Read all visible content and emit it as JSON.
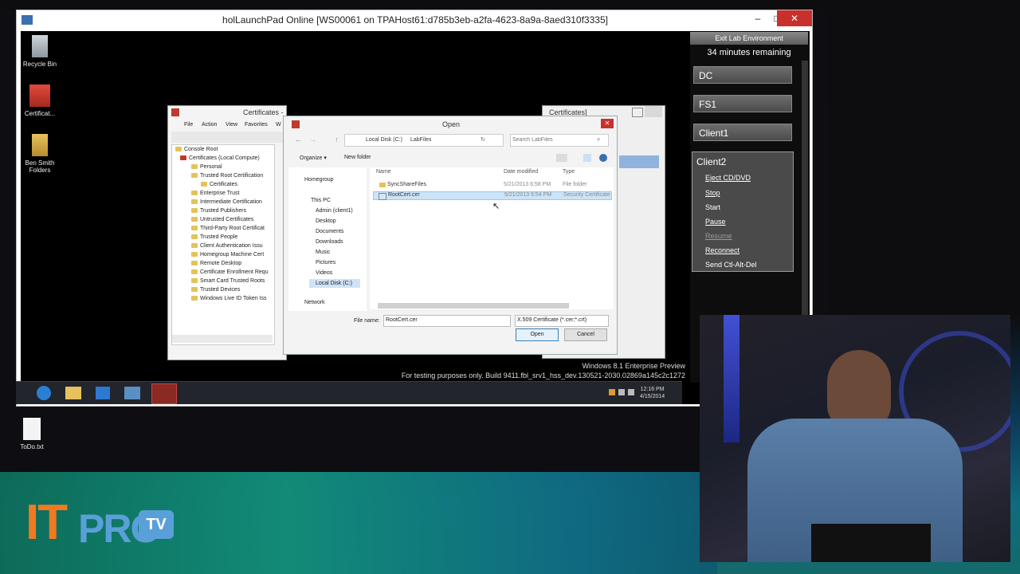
{
  "host_window": {
    "title": "holLaunchPad Online  [WS00061 on TPAHost61:d785b3eb-a2fa-4623-8a9a-8aed310f3335]",
    "minimize": "–",
    "maximize": "□",
    "close": "✕"
  },
  "vm_desktop": {
    "icons": [
      {
        "label": "Recycle Bin",
        "icon": "recycle-bin-icon"
      },
      {
        "label": "Certificat...",
        "icon": "certificate-icon"
      },
      {
        "label": "Ben Smith Folders",
        "icon": "folder-icon"
      }
    ],
    "watermark_line1": "Windows 8.1 Enterprise Preview",
    "watermark_line2": "For testing purposes only. Build 9411.fbl_srv1_hss_dev.130521-2030.02869a145c2c1272",
    "clock_time": "12:16 PM",
    "clock_date": "4/15/2014"
  },
  "outer_desktop": {
    "icons": [
      {
        "label": "ToDo.txt",
        "icon": "text-file-icon"
      }
    ]
  },
  "lab_panel": {
    "exit_label": "Exit Lab Environment",
    "remaining": "34 minutes remaining",
    "machines": [
      "DC",
      "FS1",
      "Client1",
      "Client2"
    ],
    "client2_actions": [
      "Eject CD/DVD",
      "Stop",
      "Start",
      "Pause",
      "Resume",
      "Reconnect",
      "Send Ctl-Alt-Del"
    ]
  },
  "cert_console": {
    "title": "Certificates -",
    "menu": [
      "File",
      "Action",
      "View",
      "Favorites",
      "W"
    ],
    "tree": [
      "Console Root",
      "Certificates (Local Compute)",
      "Personal",
      "Trusted Root Certification",
      "Certificates",
      "Enterprise Trust",
      "Intermediate Certification",
      "Trusted Publishers",
      "Untrusted Certificates",
      "Third-Party Root Certificat",
      "Trusted People",
      "Client Authentication Issu",
      "Homegroup Machine Cert",
      "Remote Desktop",
      "Certificate Enrollment Requ",
      "Smart Card Trusted Roots",
      "Trusted Devices",
      "Windows Live ID Token Iss"
    ]
  },
  "bg_window": {
    "title": "Certificates]"
  },
  "open_dialog": {
    "title": "Open",
    "path": [
      "Local Disk (C:)",
      "LabFiles"
    ],
    "search_placeholder": "Search LabFiles",
    "organize": "Organize ▾",
    "new_folder": "New folder",
    "nav": [
      "Homegroup",
      "This PC",
      "Admin (client1)",
      "Desktop",
      "Documents",
      "Downloads",
      "Music",
      "Pictures",
      "Videos",
      "Local Disk (C:)",
      "Network"
    ],
    "columns": [
      "Name",
      "Date modified",
      "Type"
    ],
    "files": [
      {
        "name": "SyncShareFiles",
        "date": "5/21/2013 6:58 PM",
        "type": "File folder"
      },
      {
        "name": "RootCert.cer",
        "date": "5/21/2013 6:54 PM",
        "type": "Security Certificate"
      }
    ],
    "file_name_label": "File name:",
    "file_name_value": "RootCert.cer",
    "filter": "X.509 Certificate (*.cer;*.crt)",
    "open_label": "Open",
    "cancel_label": "Cancel"
  },
  "logo": {
    "it": "IT",
    "pro": "PRO",
    "tv": "TV"
  },
  "colors": {
    "accent_orange": "#f07a22",
    "logo_blue": "#5aa0d8",
    "panel_button": "#5a5a5a"
  }
}
